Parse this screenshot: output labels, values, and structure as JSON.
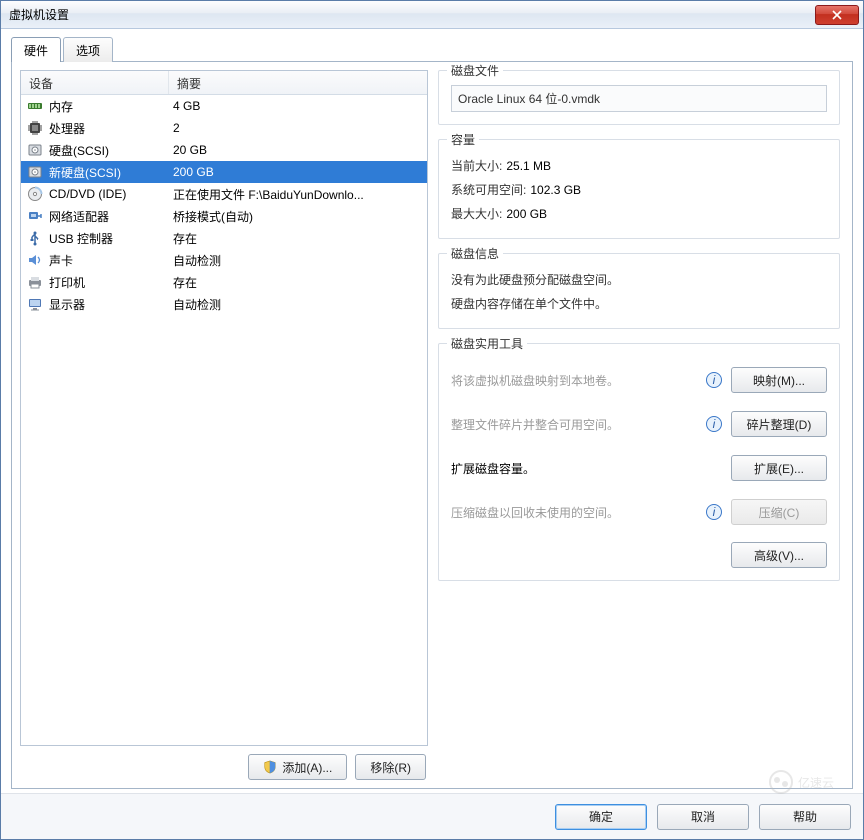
{
  "window": {
    "title": "虚拟机设置"
  },
  "tabs": {
    "hardware": "硬件",
    "options": "选项"
  },
  "hw_header": {
    "device": "设备",
    "summary": "摘要"
  },
  "hw": [
    {
      "icon": "memory",
      "device": "内存",
      "summary": "4 GB"
    },
    {
      "icon": "cpu",
      "device": "处理器",
      "summary": "2"
    },
    {
      "icon": "disk",
      "device": "硬盘(SCSI)",
      "summary": "20 GB"
    },
    {
      "icon": "disk",
      "device": "新硬盘(SCSI)",
      "summary": "200 GB",
      "selected": true
    },
    {
      "icon": "cd",
      "device": "CD/DVD (IDE)",
      "summary": "正在使用文件 F:\\BaiduYunDownlo..."
    },
    {
      "icon": "net",
      "device": "网络适配器",
      "summary": "桥接模式(自动)"
    },
    {
      "icon": "usb",
      "device": "USB 控制器",
      "summary": "存在"
    },
    {
      "icon": "sound",
      "device": "声卡",
      "summary": "自动检测"
    },
    {
      "icon": "printer",
      "device": "打印机",
      "summary": "存在"
    },
    {
      "icon": "display",
      "device": "显示器",
      "summary": "自动检测"
    }
  ],
  "left_buttons": {
    "add": "添加(A)...",
    "remove": "移除(R)"
  },
  "groups": {
    "disk_file": {
      "title": "磁盘文件",
      "value": "Oracle Linux 64 位-0.vmdk"
    },
    "capacity": {
      "title": "容量",
      "current_label": "当前大小:",
      "current_value": "25.1 MB",
      "free_label": "系统可用空间:",
      "free_value": "102.3 GB",
      "max_label": "最大大小:",
      "max_value": "200 GB"
    },
    "disk_info": {
      "title": "磁盘信息",
      "line1": "没有为此硬盘预分配磁盘空间。",
      "line2": "硬盘内容存储在单个文件中。"
    },
    "utilities": {
      "title": "磁盘实用工具",
      "map_text": "将该虚拟机磁盘映射到本地卷。",
      "map_btn": "映射(M)...",
      "defrag_text": "整理文件碎片并整合可用空间。",
      "defrag_btn": "碎片整理(D)",
      "expand_text": "扩展磁盘容量。",
      "expand_btn": "扩展(E)...",
      "compact_text": "压缩磁盘以回收未使用的空间。",
      "compact_btn": "压缩(C)",
      "advanced_btn": "高级(V)..."
    }
  },
  "footer": {
    "ok": "确定",
    "cancel": "取消",
    "help": "帮助"
  },
  "watermark": "亿速云"
}
